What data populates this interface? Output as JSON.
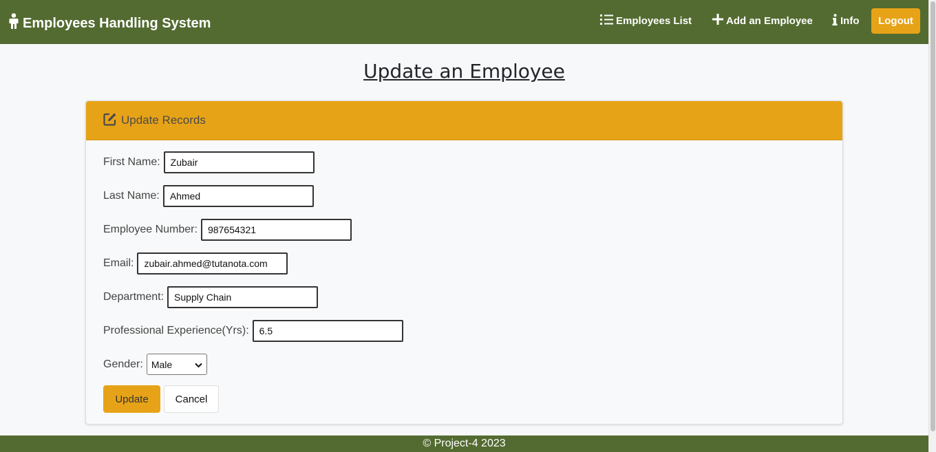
{
  "navbar": {
    "brand": "Employees Handling System",
    "brand_icon": "person-icon",
    "links": [
      {
        "label": "Employees List",
        "icon": "list-icon"
      },
      {
        "label": "Add an Employee",
        "icon": "plus-icon"
      },
      {
        "label": "Info",
        "icon": "info-icon"
      }
    ],
    "logout_label": "Logout"
  },
  "page": {
    "title": "Update an Employee"
  },
  "card": {
    "header": "Update Records",
    "header_icon": "edit-icon"
  },
  "form": {
    "first_name": {
      "label": "First Name:",
      "value": "Zubair"
    },
    "last_name": {
      "label": "Last Name:",
      "value": "Ahmed"
    },
    "employee_number": {
      "label": "Employee Number:",
      "value": "987654321"
    },
    "email": {
      "label": "Email:",
      "value": "zubair.ahmed@tutanota.com"
    },
    "department": {
      "label": "Department:",
      "value": "Supply Chain"
    },
    "experience": {
      "label": "Professional Experience(Yrs):",
      "value": "6.5"
    },
    "gender": {
      "label": "Gender:",
      "value": "Male"
    },
    "update_label": "Update",
    "cancel_label": "Cancel"
  },
  "footer": {
    "text": "© Project-4 2023"
  },
  "colors": {
    "navbar_bg": "#536b31",
    "accent": "#e7a317",
    "page_bg": "#f7f8fa"
  }
}
